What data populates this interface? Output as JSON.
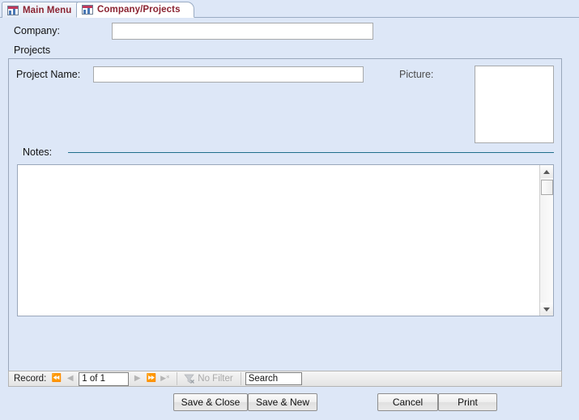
{
  "window": {
    "background_color": "#dde7f7"
  },
  "tabs": [
    {
      "label": "Main Menu",
      "icon": "form-icon",
      "active": false
    },
    {
      "label": "Company/Projects",
      "icon": "form-icon",
      "active": true
    }
  ],
  "form": {
    "company": {
      "label": "Company:",
      "value": "",
      "placeholder": ""
    },
    "projects_heading": "Projects",
    "subform": {
      "project_name": {
        "label": "Project Name:",
        "value": "",
        "placeholder": ""
      },
      "picture": {
        "label": "Picture:",
        "value": ""
      },
      "notes": {
        "label": "Notes:",
        "value": "",
        "placeholder": "",
        "rule_color": "#1f6f8b"
      }
    }
  },
  "record_nav": {
    "label": "Record:",
    "first_icon": "first-record-icon",
    "previous_icon": "previous-record-icon",
    "position": "1 of 1",
    "next_icon": "next-record-icon",
    "last_icon": "last-record-icon",
    "new_icon": "new-record-icon",
    "filter_label": "No Filter",
    "filter_icon": "filter-icon",
    "search": {
      "value": "Search",
      "placeholder": "Search"
    }
  },
  "buttons": {
    "save_close": "Save & Close",
    "save_new": "Save & New",
    "cancel": "Cancel",
    "print": "Print"
  },
  "icons": {
    "nav_first": "⏮",
    "nav_prev": "◀",
    "nav_next": "▶",
    "nav_last": "⏭",
    "nav_new": "▶*",
    "scroll_up": "scroll-up-arrow",
    "scroll_down": "scroll-down-arrow"
  },
  "colors": {
    "tab_text": "#8b2331",
    "background": "#dde7f7",
    "notes_rule": "#1f6f8b",
    "field_border": "#a7a9ab"
  }
}
